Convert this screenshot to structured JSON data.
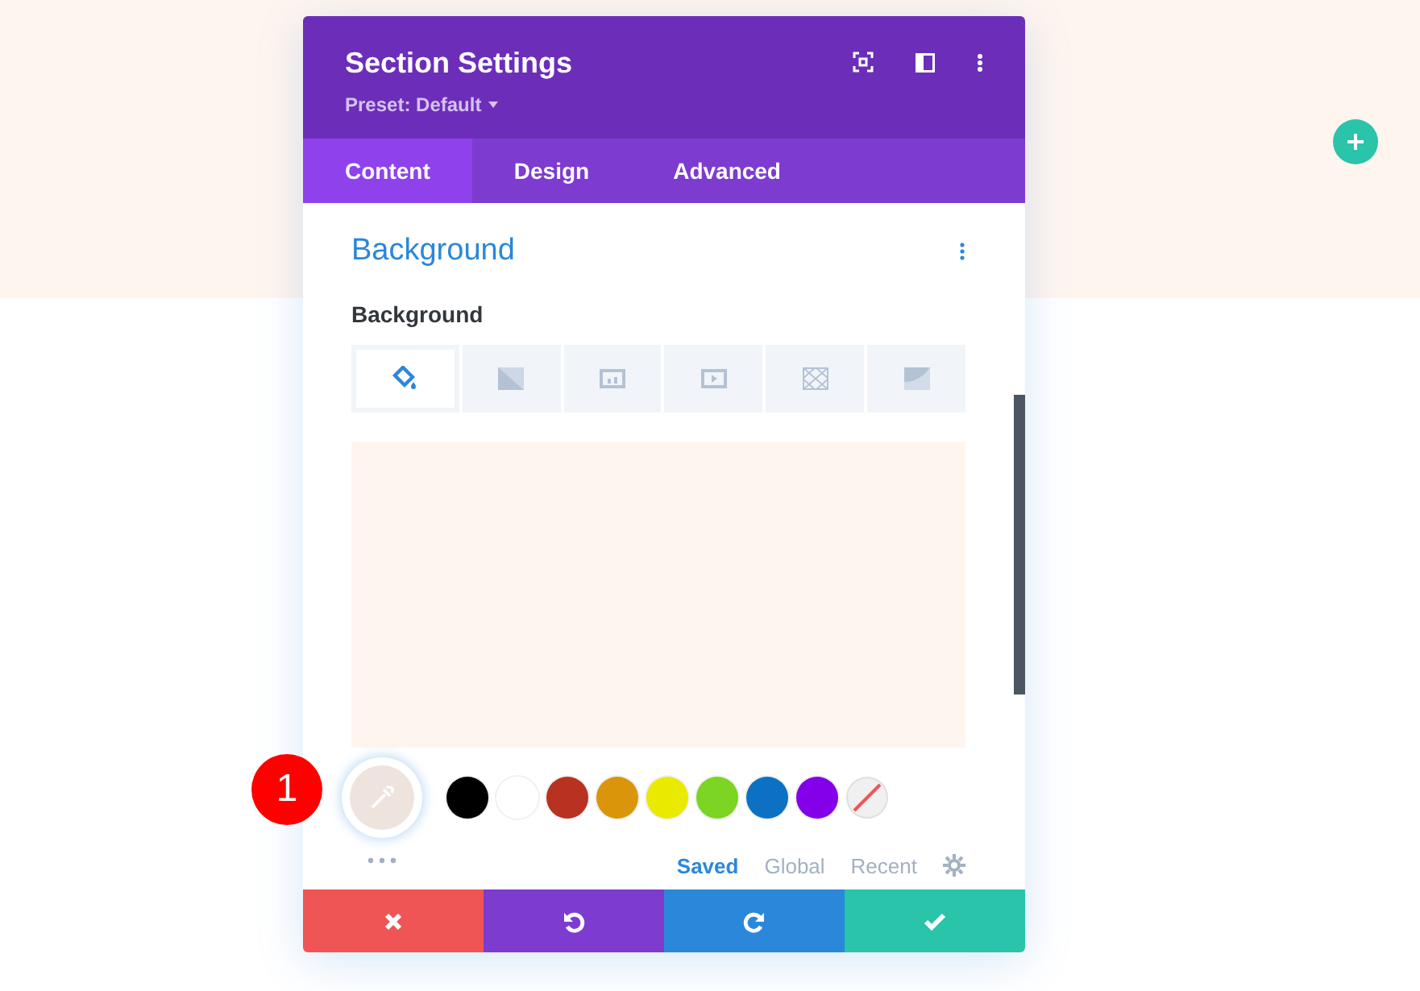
{
  "window": {
    "title": "Section Settings",
    "preset": "Preset: Default"
  },
  "tabs": [
    {
      "label": "Content",
      "selected": true
    },
    {
      "label": "Design",
      "selected": false
    },
    {
      "label": "Advanced",
      "selected": false
    }
  ],
  "section": {
    "title": "Background",
    "field_label": "Background"
  },
  "background_types": [
    {
      "kind": "color",
      "selected": true
    },
    {
      "kind": "gradient",
      "selected": false
    },
    {
      "kind": "image",
      "selected": false
    },
    {
      "kind": "video",
      "selected": false
    },
    {
      "kind": "pattern",
      "selected": false
    },
    {
      "kind": "mask",
      "selected": false
    }
  ],
  "preview": {
    "color": "#fff5ef"
  },
  "current_color": {
    "color": "#efe3dd"
  },
  "callout": "1",
  "swatches": [
    {
      "color": "#000000"
    },
    {
      "color": "#ffffff"
    },
    {
      "color": "#b93121"
    },
    {
      "color": "#da950a"
    },
    {
      "color": "#eaea00"
    },
    {
      "color": "#7cd423"
    },
    {
      "color": "#0c71c3"
    },
    {
      "color": "#8300e9"
    },
    {
      "kind": "none"
    }
  ],
  "palette_tabs": [
    {
      "label": "Saved",
      "selected": true
    },
    {
      "label": "Global",
      "selected": false
    },
    {
      "label": "Recent",
      "selected": false
    }
  ],
  "actions": [
    {
      "kind": "cancel"
    },
    {
      "kind": "undo"
    },
    {
      "kind": "redo"
    },
    {
      "kind": "save"
    }
  ]
}
